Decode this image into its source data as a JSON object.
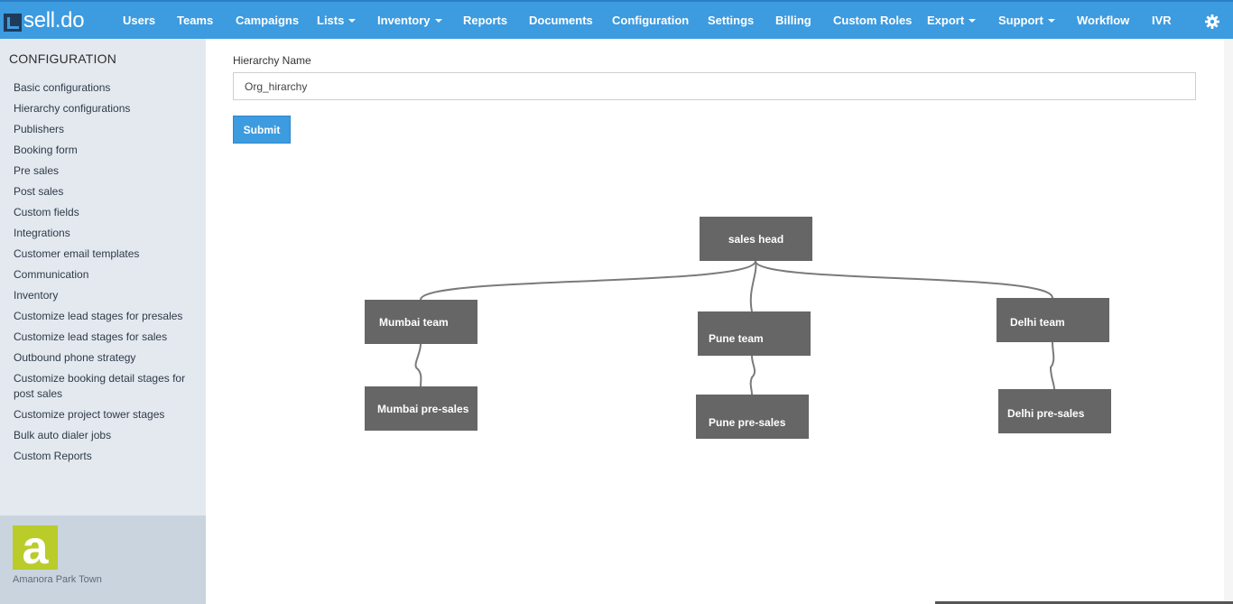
{
  "app": {
    "logo_text": "sell.do"
  },
  "nav": {
    "items": [
      {
        "label": "Users",
        "dropdown": false
      },
      {
        "label": "Teams",
        "dropdown": false
      },
      {
        "label": "Campaigns",
        "dropdown": false
      },
      {
        "label": "Lists",
        "dropdown": true
      },
      {
        "label": "Inventory",
        "dropdown": true
      },
      {
        "label": "Reports",
        "dropdown": false
      },
      {
        "label": "Documents",
        "dropdown": false
      },
      {
        "label": "Configuration",
        "dropdown": false
      },
      {
        "label": "Settings",
        "dropdown": false
      },
      {
        "label": "Billing",
        "dropdown": false
      },
      {
        "label": "Custom Roles",
        "dropdown": false
      },
      {
        "label": "Export",
        "dropdown": true
      },
      {
        "label": "Support",
        "dropdown": true
      },
      {
        "label": "Workflow",
        "dropdown": false
      },
      {
        "label": "IVR",
        "dropdown": false
      }
    ],
    "settings_icon": "gear-icon"
  },
  "sidebar": {
    "title": "CONFIGURATION",
    "links": [
      "Basic configurations",
      "Hierarchy configurations",
      "Publishers",
      "Booking form",
      "Pre sales",
      "Post sales",
      "Custom fields",
      "Integrations",
      "Customer email templates",
      "Communication",
      "Inventory",
      "Customize lead stages for presales",
      "Customize lead stages for sales",
      "Outbound phone strategy",
      "Customize booking detail stages for post sales",
      "Customize project tower stages",
      "Bulk auto dialer jobs",
      "Custom Reports"
    ],
    "footer": {
      "brand_letter": "a",
      "caption": "Amanora Park Town"
    }
  },
  "form": {
    "label": "Hierarchy Name",
    "value": "Org_hirarchy",
    "submit_label": "Submit"
  },
  "hierarchy": {
    "root": "sales head",
    "teams": [
      {
        "name": "Mumbai team",
        "child": "Mumbai pre-sales"
      },
      {
        "name": "Pune team",
        "child": "Pune pre-sales"
      },
      {
        "name": "Delhi team",
        "child": "Delhi pre-sales"
      }
    ]
  },
  "colors": {
    "nav_bg": "#3d9be0",
    "sidebar_bg": "#e4e9ef",
    "node_bg": "#666666",
    "brand_green": "#b9cc2a"
  }
}
